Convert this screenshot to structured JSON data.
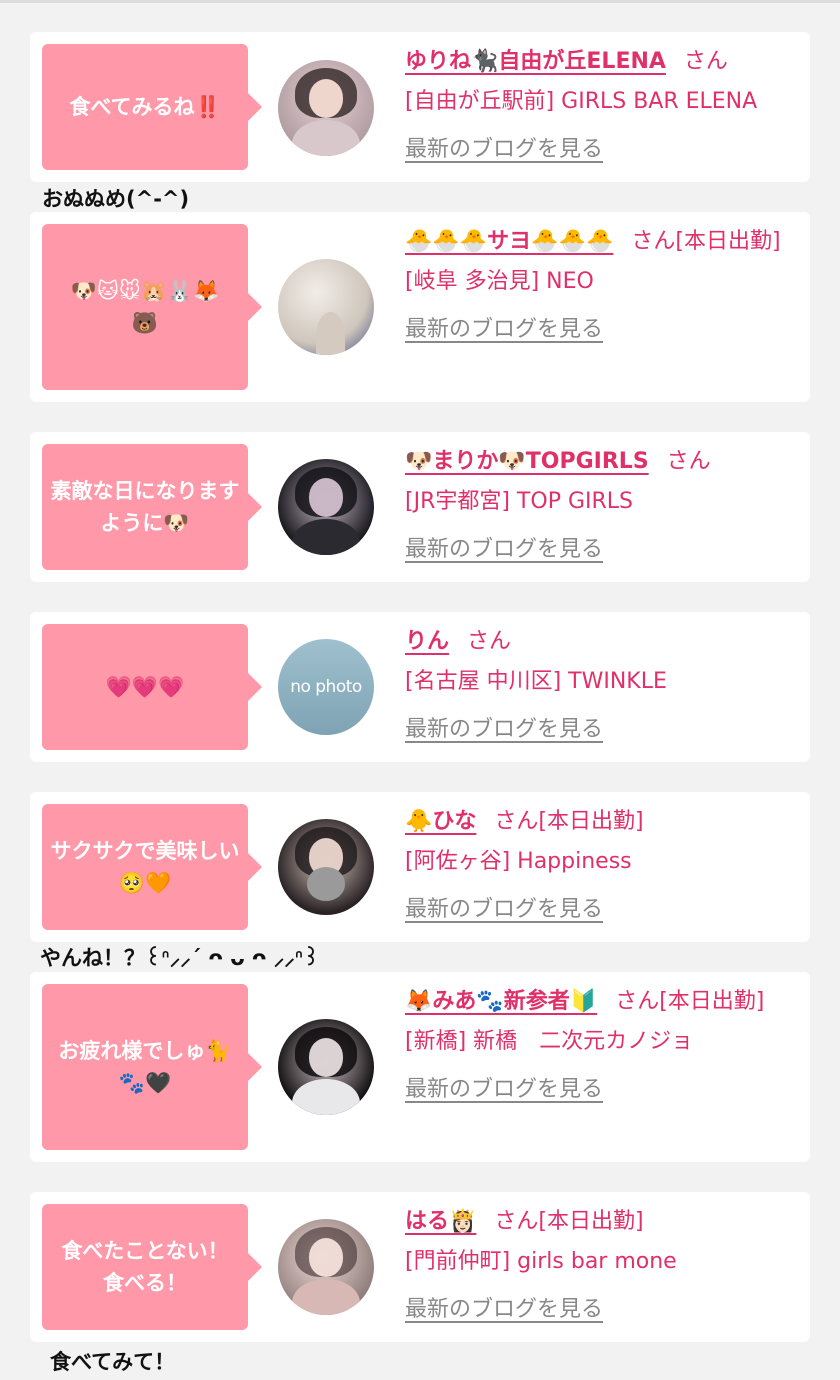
{
  "colors": {
    "background": "#f2f2f2",
    "card": "#ffffff",
    "bubble": "#ff98a8",
    "accent": "#e0306a",
    "link_gray": "#888888"
  },
  "blog_link_label": "最新のブログを見る",
  "posts": [
    {
      "bubble": "食べてみるね‼️",
      "name": "ゆりね🐈‍⬛自由が丘ELENA",
      "san": "さん",
      "shop": "[自由が丘駅前] GIRLS BAR ELENA",
      "avatar_icon": "girl-photo-avatar-icon"
    },
    {
      "bubble": "🐶🐱🐭🐹🐰🦊\n🐻",
      "name": "🐣🐣🐣サヨ🐣🐣🐣",
      "san": "さん[本日出勤]",
      "shop": "[岐阜 多治見] NEO",
      "avatar_icon": "photo-avatar-icon"
    },
    {
      "bubble": "素敵な日になりますように🐶",
      "name": "🐶まりか🐶TOPGIRLS",
      "san": "さん",
      "shop": "[JR宇都宮] TOP GIRLS",
      "avatar_icon": "girl-photo-avatar-icon"
    },
    {
      "bubble": "💗💗💗",
      "name": "りん",
      "san": "さん",
      "shop": "[名古屋 中川区] TWINKLE",
      "avatar_icon": "no-photo-avatar-icon",
      "avatar_text": "no photo"
    },
    {
      "bubble": "サクサクで美味しい🥺🧡",
      "name": "🐥ひな",
      "san": "さん[本日出勤]",
      "shop": "[阿佐ヶ谷] Happiness",
      "avatar_icon": "girl-photo-avatar-icon"
    },
    {
      "bubble": "お疲れ様でしゅ🐈\n🐾🖤",
      "name": "🦊みあ🐾新参者🔰",
      "san": "さん[本日出勤]",
      "shop": "[新橋] 新橋　二次元カノジョ",
      "avatar_icon": "girl-photo-avatar-icon"
    },
    {
      "bubble": "食べたことない！\n食べる！",
      "name": "はる👸🏻",
      "san": "さん[本日出勤]",
      "shop": "[門前仲町] girls bar mone",
      "avatar_icon": "girl-photo-avatar-icon"
    }
  ],
  "comments": [
    "おぬぬめ(^-^)",
    "やんね！？꒰ᐢ⸝⸝´ ᴖ ᴗ ᴖ ⸝⸝ᐢ꒱",
    "食べてみて！"
  ]
}
